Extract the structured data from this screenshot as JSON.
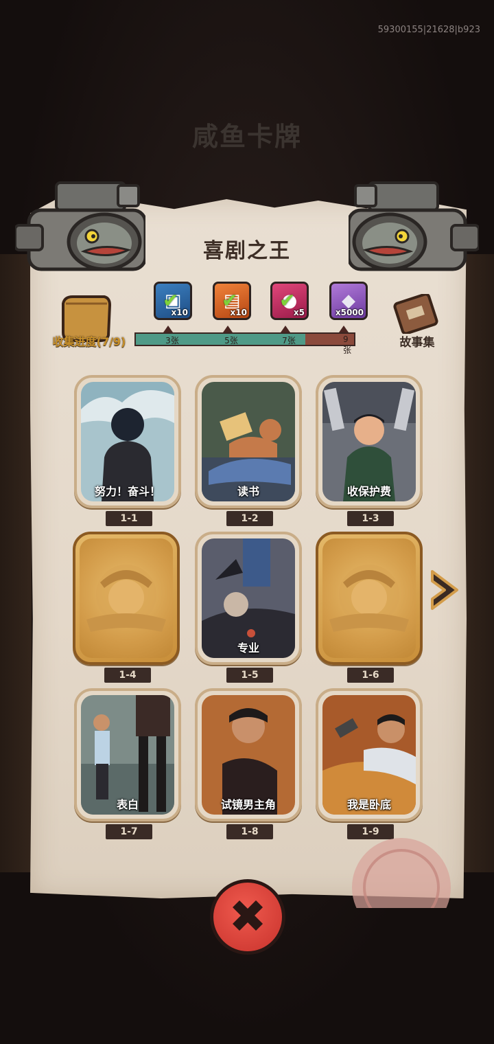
{
  "build_id": "59300155|21628|b923",
  "background_title": "咸鱼卡牌",
  "panel": {
    "title": "喜剧之王",
    "collect_label": "收集进度(7/9)",
    "story_label": "故事集"
  },
  "rewards": [
    {
      "qty": "x10",
      "icon": "chest-icon",
      "claimed": true
    },
    {
      "qty": "x10",
      "icon": "ticket-icon",
      "claimed": true
    },
    {
      "qty": "x5",
      "icon": "orb-icon",
      "claimed": true
    },
    {
      "qty": "x5000",
      "icon": "diamond-icon",
      "claimed": false
    }
  ],
  "progress": {
    "collected": 7,
    "total": 9,
    "milestones": [
      "3张",
      "5张",
      "7张",
      "9张"
    ]
  },
  "cards": [
    {
      "id": "1-1",
      "title": "努力！奋斗！",
      "locked": false
    },
    {
      "id": "1-2",
      "title": "读书",
      "locked": false
    },
    {
      "id": "1-3",
      "title": "收保护费",
      "locked": false
    },
    {
      "id": "1-4",
      "title": "",
      "locked": true
    },
    {
      "id": "1-5",
      "title": "专业",
      "locked": false
    },
    {
      "id": "1-6",
      "title": "",
      "locked": true
    },
    {
      "id": "1-7",
      "title": "表白",
      "locked": false
    },
    {
      "id": "1-8",
      "title": "试镜男主角",
      "locked": false
    },
    {
      "id": "1-9",
      "title": "我是卧底",
      "locked": false
    }
  ],
  "colors": {
    "progress_filled": "#4f9a87",
    "progress_empty": "#8b4a3c",
    "close_button": "#e0453b",
    "gold": "#c8902a"
  }
}
